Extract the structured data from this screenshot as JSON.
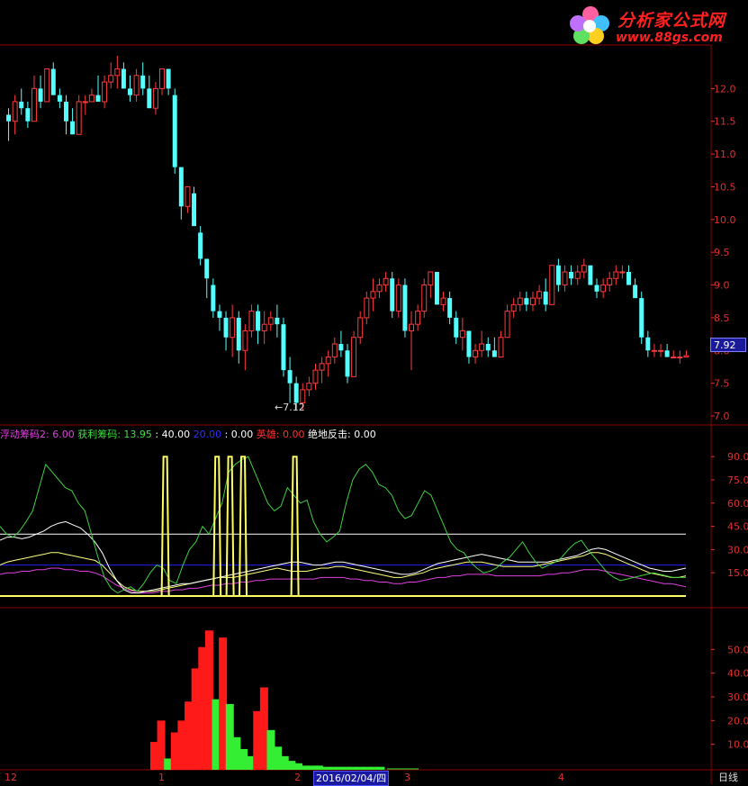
{
  "logo": {
    "title": "分析家公式网",
    "url": "www.88gs.com"
  },
  "price_panel": {
    "y_ticks": [
      "12.0",
      "11.5",
      "11.0",
      "10.5",
      "10.0",
      "9.5",
      "9.0",
      "8.5",
      "8.0",
      "7.5",
      "7.0"
    ],
    "last_price": "7.92",
    "low_label": "←7.12"
  },
  "indicator_panel": {
    "legend": [
      {
        "text": "浮动筹码2: 6.00",
        "color": "#e040e0"
      },
      {
        "text": "  获利筹码: 13.95",
        "color": "#40e040"
      },
      {
        "text": " : 40.00",
        "color": "#ffffff"
      },
      {
        "text": "   20.00",
        "color": "#3030ff"
      },
      {
        "text": " : 0.00",
        "color": "#ffffff"
      },
      {
        "text": "  英雄: 0.00",
        "color": "#ff3030"
      },
      {
        "text": "  绝地反击: 0.00",
        "color": "#ffffff"
      }
    ],
    "y_ticks": [
      "90.0",
      "75.0",
      "60.0",
      "45.0",
      "30.0",
      "15.0"
    ]
  },
  "volume_panel": {
    "y_ticks": [
      "50.0",
      "40.0",
      "30.0",
      "20.0",
      "10.0"
    ]
  },
  "x_axis": {
    "labels": [
      "12",
      "1",
      "2",
      "3",
      "4"
    ],
    "cursor_date": "2016/02/04/四",
    "period": "日线"
  },
  "chart_data": {
    "type": "candlestick",
    "ylim": [
      7.0,
      12.5
    ],
    "candles": [
      [
        11.6,
        11.7,
        11.2,
        11.5
      ],
      [
        11.5,
        11.9,
        11.3,
        11.8
      ],
      [
        11.8,
        12.0,
        11.6,
        11.7
      ],
      [
        11.7,
        11.8,
        11.4,
        11.5
      ],
      [
        11.5,
        12.2,
        11.5,
        12.0
      ],
      [
        12.0,
        12.2,
        11.7,
        11.8
      ],
      [
        11.8,
        12.3,
        11.8,
        12.3
      ],
      [
        12.3,
        12.4,
        11.9,
        11.9
      ],
      [
        11.9,
        12.0,
        11.7,
        11.8
      ],
      [
        11.8,
        11.9,
        11.3,
        11.5
      ],
      [
        11.5,
        11.7,
        11.3,
        11.3
      ],
      [
        11.3,
        11.9,
        11.3,
        11.8
      ],
      [
        11.8,
        11.9,
        11.6,
        11.8
      ],
      [
        11.8,
        12.0,
        11.8,
        11.9
      ],
      [
        11.9,
        12.2,
        11.8,
        11.8
      ],
      [
        11.8,
        12.2,
        11.7,
        12.1
      ],
      [
        12.1,
        12.4,
        12.0,
        12.2
      ],
      [
        12.2,
        12.5,
        12.0,
        12.3
      ],
      [
        12.3,
        12.4,
        12.0,
        12.0
      ],
      [
        12.0,
        12.2,
        11.8,
        11.9
      ],
      [
        11.9,
        12.3,
        11.8,
        12.2
      ],
      [
        12.2,
        12.4,
        11.9,
        12.0
      ],
      [
        12.0,
        12.2,
        11.7,
        11.7
      ],
      [
        11.7,
        12.1,
        11.6,
        12.0
      ],
      [
        12.0,
        12.3,
        11.9,
        12.3
      ],
      [
        12.3,
        12.3,
        11.9,
        12.0
      ],
      [
        11.9,
        12.0,
        10.7,
        10.8
      ],
      [
        10.8,
        10.8,
        10.0,
        10.2
      ],
      [
        10.2,
        10.5,
        10.1,
        10.5
      ],
      [
        10.4,
        10.5,
        9.9,
        9.9
      ],
      [
        9.8,
        9.9,
        9.3,
        9.4
      ],
      [
        9.4,
        9.4,
        8.8,
        9.1
      ],
      [
        9.0,
        9.1,
        8.5,
        8.6
      ],
      [
        8.6,
        8.7,
        8.3,
        8.5
      ],
      [
        8.5,
        8.6,
        8.0,
        8.2
      ],
      [
        8.2,
        8.7,
        7.9,
        8.5
      ],
      [
        8.5,
        8.6,
        7.8,
        8.0
      ],
      [
        8.0,
        8.4,
        7.7,
        8.3
      ],
      [
        8.3,
        8.7,
        8.2,
        8.6
      ],
      [
        8.6,
        8.7,
        8.1,
        8.3
      ],
      [
        8.3,
        8.6,
        8.1,
        8.4
      ],
      [
        8.4,
        8.6,
        8.3,
        8.5
      ],
      [
        8.5,
        8.7,
        8.2,
        8.4
      ],
      [
        8.4,
        8.5,
        7.6,
        7.7
      ],
      [
        7.7,
        7.9,
        7.2,
        7.5
      ],
      [
        7.5,
        7.6,
        7.1,
        7.2
      ],
      [
        7.2,
        7.5,
        7.1,
        7.4
      ],
      [
        7.4,
        7.6,
        7.3,
        7.5
      ],
      [
        7.5,
        7.8,
        7.4,
        7.7
      ],
      [
        7.7,
        7.9,
        7.5,
        7.8
      ],
      [
        7.8,
        8.0,
        7.6,
        7.9
      ],
      [
        7.9,
        8.2,
        7.8,
        8.1
      ],
      [
        8.1,
        8.3,
        7.9,
        8.0
      ],
      [
        8.0,
        8.1,
        7.5,
        7.6
      ],
      [
        7.6,
        8.3,
        7.6,
        8.2
      ],
      [
        8.2,
        8.6,
        8.1,
        8.5
      ],
      [
        8.5,
        8.9,
        8.4,
        8.8
      ],
      [
        8.8,
        9.1,
        8.6,
        8.9
      ],
      [
        8.9,
        9.1,
        8.8,
        9.0
      ],
      [
        9.0,
        9.2,
        8.9,
        9.1
      ],
      [
        9.1,
        9.2,
        8.5,
        8.6
      ],
      [
        8.6,
        9.1,
        8.5,
        9.0
      ],
      [
        9.0,
        9.1,
        8.2,
        8.3
      ],
      [
        8.3,
        8.6,
        7.7,
        8.4
      ],
      [
        8.4,
        8.7,
        8.3,
        8.6
      ],
      [
        8.6,
        9.1,
        8.5,
        9.0
      ],
      [
        9.0,
        9.2,
        8.8,
        9.2
      ],
      [
        9.2,
        9.2,
        8.7,
        8.7
      ],
      [
        8.7,
        8.9,
        8.6,
        8.8
      ],
      [
        8.8,
        8.9,
        8.4,
        8.5
      ],
      [
        8.5,
        8.6,
        8.1,
        8.2
      ],
      [
        8.2,
        8.5,
        8.0,
        8.3
      ],
      [
        8.3,
        8.3,
        7.8,
        7.9
      ],
      [
        7.9,
        8.1,
        7.8,
        8.0
      ],
      [
        8.0,
        8.3,
        7.9,
        8.1
      ],
      [
        8.1,
        8.2,
        7.9,
        8.0
      ],
      [
        8.0,
        8.2,
        7.9,
        7.9
      ],
      [
        7.9,
        8.3,
        7.9,
        8.2
      ],
      [
        8.2,
        8.7,
        8.2,
        8.6
      ],
      [
        8.6,
        8.8,
        8.5,
        8.7
      ],
      [
        8.7,
        8.9,
        8.6,
        8.8
      ],
      [
        8.8,
        8.9,
        8.6,
        8.7
      ],
      [
        8.7,
        8.9,
        8.6,
        8.8
      ],
      [
        8.8,
        9.0,
        8.7,
        8.9
      ],
      [
        8.9,
        9.1,
        8.6,
        8.7
      ],
      [
        8.7,
        9.3,
        8.7,
        9.3
      ],
      [
        9.3,
        9.4,
        8.9,
        9.0
      ],
      [
        9.0,
        9.3,
        8.9,
        9.2
      ],
      [
        9.2,
        9.3,
        9.0,
        9.1
      ],
      [
        9.1,
        9.3,
        9.0,
        9.2
      ],
      [
        9.2,
        9.4,
        9.1,
        9.3
      ],
      [
        9.3,
        9.3,
        9.0,
        9.0
      ],
      [
        9.0,
        9.1,
        8.8,
        8.9
      ],
      [
        8.9,
        9.1,
        8.8,
        9.0
      ],
      [
        9.0,
        9.2,
        8.9,
        9.1
      ],
      [
        9.1,
        9.3,
        9.0,
        9.2
      ],
      [
        9.2,
        9.3,
        9.1,
        9.2
      ],
      [
        9.2,
        9.3,
        9.0,
        9.0
      ],
      [
        9.0,
        9.1,
        8.8,
        8.8
      ],
      [
        8.8,
        8.9,
        8.1,
        8.2
      ],
      [
        8.2,
        8.3,
        7.9,
        8.0
      ],
      [
        8.0,
        8.1,
        7.9,
        8.0
      ],
      [
        8.0,
        8.1,
        7.9,
        8.0
      ],
      [
        8.0,
        8.1,
        7.9,
        7.9
      ],
      [
        7.9,
        8.0,
        7.9,
        7.9
      ],
      [
        7.9,
        8.0,
        7.8,
        7.9
      ],
      [
        7.9,
        8.0,
        7.9,
        7.92
      ]
    ],
    "indicator_ylim": [
      0,
      100
    ],
    "green_series": [
      45,
      40,
      38,
      42,
      48,
      55,
      70,
      85,
      80,
      75,
      70,
      68,
      60,
      55,
      40,
      25,
      12,
      5,
      2,
      4,
      6,
      3,
      8,
      15,
      20,
      18,
      10,
      8,
      20,
      30,
      35,
      45,
      40,
      50,
      60,
      80,
      85,
      88,
      90,
      80,
      70,
      60,
      55,
      58,
      70,
      65,
      60,
      62,
      48,
      40,
      35,
      38,
      42,
      60,
      75,
      82,
      85,
      80,
      72,
      70,
      65,
      55,
      50,
      52,
      60,
      68,
      65,
      55,
      45,
      35,
      30,
      28,
      22,
      18,
      15,
      16,
      18,
      22,
      25,
      30,
      35,
      28,
      22,
      18,
      20,
      22,
      25,
      30,
      34,
      36,
      30,
      25,
      20,
      15,
      12,
      10,
      11,
      12,
      13,
      14,
      15,
      14,
      13,
      12,
      12,
      12
    ],
    "white_series": [
      36,
      38,
      38,
      37,
      38,
      40,
      42,
      45,
      47,
      48,
      46,
      44,
      40,
      35,
      28,
      18,
      10,
      4,
      2,
      2,
      3,
      4,
      5,
      6,
      7,
      8,
      8,
      9,
      10,
      11,
      12,
      13,
      14,
      15,
      16,
      17,
      18,
      19,
      20,
      21,
      22,
      22,
      21,
      20,
      20,
      21,
      22,
      22,
      21,
      20,
      19,
      18,
      17,
      16,
      15,
      14,
      14,
      15,
      17,
      19,
      21,
      22,
      23,
      24,
      25,
      26,
      27,
      26,
      25,
      24,
      23,
      22,
      22,
      22,
      22,
      22,
      23,
      24,
      25,
      26,
      28,
      30,
      31,
      30,
      28,
      26,
      24,
      22,
      20,
      18,
      17,
      16,
      16,
      17,
      18
    ],
    "yellow_series": [
      20,
      22,
      23,
      24,
      25,
      26,
      27,
      28,
      28,
      27,
      26,
      25,
      24,
      23,
      20,
      15,
      10,
      6,
      4,
      3,
      3,
      3,
      4,
      5,
      6,
      7,
      8,
      9,
      10,
      11,
      12,
      12,
      12,
      13,
      14,
      15,
      16,
      17,
      18,
      17,
      16,
      16,
      16,
      17,
      18,
      18,
      19,
      19,
      18,
      17,
      16,
      15,
      14,
      13,
      12,
      12,
      13,
      14,
      15,
      17,
      18,
      19,
      20,
      21,
      22,
      22,
      22,
      21,
      20,
      19,
      19,
      19,
      19,
      19,
      20,
      21,
      22,
      23,
      24,
      25,
      26,
      28,
      28,
      27,
      25,
      23,
      21,
      19,
      17,
      15,
      14,
      13,
      12,
      12,
      13
    ],
    "magenta_series": [
      14,
      15,
      15,
      16,
      16,
      17,
      17,
      18,
      18,
      17,
      17,
      16,
      16,
      15,
      13,
      10,
      7,
      5,
      3,
      2,
      2,
      2,
      3,
      3,
      4,
      4,
      5,
      5,
      6,
      7,
      7,
      8,
      8,
      9,
      9,
      10,
      10,
      11,
      11,
      11,
      11,
      11,
      11,
      11,
      12,
      12,
      12,
      12,
      11,
      11,
      10,
      10,
      9,
      9,
      8,
      8,
      9,
      9,
      10,
      11,
      12,
      12,
      13,
      13,
      14,
      14,
      14,
      14,
      13,
      13,
      13,
      13,
      13,
      13,
      13,
      14,
      14,
      15,
      15,
      16,
      17,
      17,
      17,
      16,
      15,
      14,
      13,
      12,
      11,
      10,
      9,
      8,
      8,
      7,
      6
    ],
    "spikes_at": [
      0.255,
      0.335,
      0.355,
      0.375,
      0.455
    ],
    "h_lines": [
      40,
      20,
      0
    ],
    "volume_ylim": [
      0,
      60
    ],
    "volume": [
      {
        "x": 0.225,
        "v": 11,
        "c": "red"
      },
      {
        "x": 0.235,
        "v": 20,
        "c": "red"
      },
      {
        "x": 0.245,
        "v": 4,
        "c": "green"
      },
      {
        "x": 0.255,
        "v": 15,
        "c": "red"
      },
      {
        "x": 0.265,
        "v": 20,
        "c": "red"
      },
      {
        "x": 0.275,
        "v": 28,
        "c": "red"
      },
      {
        "x": 0.285,
        "v": 42,
        "c": "red"
      },
      {
        "x": 0.295,
        "v": 51,
        "c": "red"
      },
      {
        "x": 0.305,
        "v": 58,
        "c": "red"
      },
      {
        "x": 0.315,
        "v": 29,
        "c": "green"
      },
      {
        "x": 0.325,
        "v": 55,
        "c": "red"
      },
      {
        "x": 0.335,
        "v": 27,
        "c": "green"
      },
      {
        "x": 0.345,
        "v": 13,
        "c": "green"
      },
      {
        "x": 0.355,
        "v": 8,
        "c": "green"
      },
      {
        "x": 0.365,
        "v": 5,
        "c": "green"
      },
      {
        "x": 0.375,
        "v": 24,
        "c": "red"
      },
      {
        "x": 0.385,
        "v": 34,
        "c": "red"
      },
      {
        "x": 0.395,
        "v": 16,
        "c": "green"
      },
      {
        "x": 0.405,
        "v": 9,
        "c": "green"
      },
      {
        "x": 0.415,
        "v": 5,
        "c": "green"
      },
      {
        "x": 0.425,
        "v": 3,
        "c": "green"
      },
      {
        "x": 0.435,
        "v": 2,
        "c": "green"
      },
      {
        "x": 0.445,
        "v": 1,
        "c": "green"
      },
      {
        "x": 0.455,
        "v": 1,
        "c": "green"
      },
      {
        "x": 0.465,
        "v": 1,
        "c": "green"
      },
      {
        "x": 0.475,
        "v": 0.5,
        "c": "green"
      },
      {
        "x": 0.485,
        "v": 0.5,
        "c": "green"
      },
      {
        "x": 0.495,
        "v": 0.5,
        "c": "green"
      },
      {
        "x": 0.505,
        "v": 0.5,
        "c": "green"
      },
      {
        "x": 0.515,
        "v": 0.5,
        "c": "green"
      },
      {
        "x": 0.525,
        "v": 0.5,
        "c": "green"
      },
      {
        "x": 0.535,
        "v": 0.5,
        "c": "green"
      },
      {
        "x": 0.545,
        "v": 0.5,
        "c": "green"
      },
      {
        "x": 0.555,
        "v": 0.5,
        "c": "green"
      }
    ],
    "colors": {
      "up": "#ff3b3b",
      "down": "#54ffff",
      "grid": "#8b0000",
      "axis": "#e03030"
    }
  }
}
